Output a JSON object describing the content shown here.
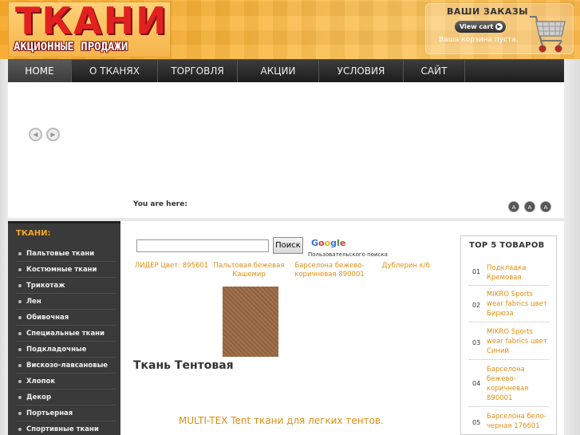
{
  "header": {
    "logo_title": "ТКАНИ",
    "logo_subtitle": "АКЦИОННЫЕ ПРОДАЖИ",
    "cart_title": "ВАШИ ЗАКАЗЫ",
    "view_cart": "View cart",
    "cart_empty": "Ваша корзина пуста."
  },
  "nav": {
    "items": [
      {
        "label": "HOME"
      },
      {
        "label": "О ТКАНЯХ"
      },
      {
        "label": "ТОРГОВЛЯ"
      },
      {
        "label": "АКЦИИ"
      },
      {
        "label": "УСЛОВИЯ"
      },
      {
        "label": "САЙТ"
      }
    ]
  },
  "banner": {
    "you_are_here": "You are here:",
    "font_buttons": [
      "A",
      "A",
      "A"
    ]
  },
  "left_sidebar": {
    "title": "ТКАНИ:",
    "items": [
      "Пальтовые ткани",
      "Костюмные ткани",
      "Трикотаж",
      "Лен",
      "Обивочная",
      "Специальные ткани",
      "Подкладочные",
      "Вискозо-лавсановые",
      "Хлопок",
      "Декор",
      "Портьерная",
      "Спортивные ткани"
    ]
  },
  "main": {
    "search_button": "Поиск",
    "google_label": "Google",
    "google_sub": "Пользовательского поиска",
    "product_links": [
      "ЛИДЕР Цвет: 895601",
      "Пальтовая бежевая Кашемир",
      "Барселона бежево-коричневая 890001",
      "Дублерин к/6"
    ],
    "product_title": "Ткань Тентовая",
    "product_description": "MULTI-TEX Tent ткани для легких тентов."
  },
  "right_sidebar": {
    "title": "TOP 5 ТОВАРОВ",
    "items": [
      {
        "num": "01",
        "name": "Подкладка Кремовая"
      },
      {
        "num": "02",
        "name": "MIKRO Sports wear fabrics цвет Бирюза"
      },
      {
        "num": "03",
        "name": "MIKRO Sports wear fabrics цвет Синий"
      },
      {
        "num": "04",
        "name": "Барселона бежево-коричневая 890001"
      },
      {
        "num": "05",
        "name": "Барселона бело-черная 176601"
      }
    ]
  },
  "colors": {
    "accent": "#f5a623",
    "link": "#e08e10",
    "logo_red": "#e32020"
  }
}
